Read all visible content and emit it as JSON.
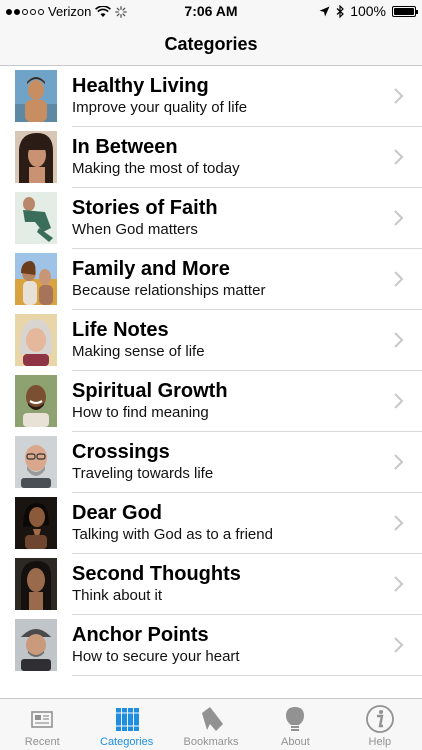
{
  "status": {
    "carrier": "Verizon",
    "time": "7:06 AM",
    "battery": "100%",
    "signal_bars": 2,
    "battery_level": 1.0
  },
  "nav": {
    "title": "Categories"
  },
  "items": [
    {
      "title": "Healthy Living",
      "subtitle": "Improve your quality of life",
      "avatar": "shirtless-boy-portrait"
    },
    {
      "title": "In Between",
      "subtitle": "Making the most of today",
      "avatar": "woman-dark-hair-portrait"
    },
    {
      "title": "Stories of Faith",
      "subtitle": "When God matters",
      "avatar": "person-sitting-green-portrait"
    },
    {
      "title": "Family and More",
      "subtitle": "Because relationships matter",
      "avatar": "couple-field-portrait"
    },
    {
      "title": "Life Notes",
      "subtitle": "Making sense of life",
      "avatar": "older-woman-portrait"
    },
    {
      "title": "Spiritual Growth",
      "subtitle": "How to find meaning",
      "avatar": "smiling-man-portrait"
    },
    {
      "title": "Crossings",
      "subtitle": "Traveling towards life",
      "avatar": "bald-man-glasses-portrait"
    },
    {
      "title": "Dear God",
      "subtitle": "Talking with God as to a friend",
      "avatar": "praying-woman-portrait"
    },
    {
      "title": "Second Thoughts",
      "subtitle": "Think about it",
      "avatar": "woman-long-hair-portrait"
    },
    {
      "title": "Anchor Points",
      "subtitle": "How to secure your heart",
      "avatar": "man-cap-portrait"
    }
  ],
  "tabs": [
    {
      "label": "Recent",
      "icon": "newspaper-icon",
      "active": false
    },
    {
      "label": "Categories",
      "icon": "books-icon",
      "active": true
    },
    {
      "label": "Bookmarks",
      "icon": "bookmark-icon",
      "active": false
    },
    {
      "label": "About",
      "icon": "lightbulb-icon",
      "active": false
    },
    {
      "label": "Help",
      "icon": "info-icon",
      "active": false
    }
  ],
  "colors": {
    "accent": "#1e8fe0",
    "inactive": "#929292",
    "bar_background": "#f7f7f7"
  }
}
